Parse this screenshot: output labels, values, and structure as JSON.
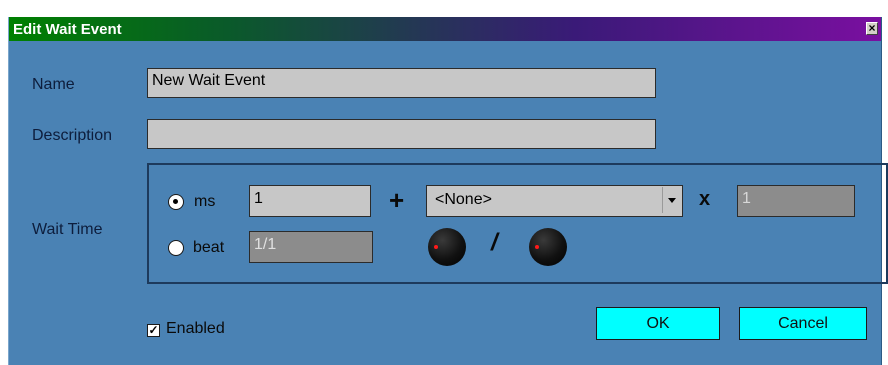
{
  "window": {
    "title": "Edit Wait Event",
    "close_glyph": "×"
  },
  "form": {
    "name_label": "Name",
    "name_value": "New Wait Event",
    "description_label": "Description",
    "description_value": "",
    "wait_time_label": "Wait Time"
  },
  "wait_time": {
    "ms_label": "ms",
    "ms_value": "1",
    "ms_selected": true,
    "beat_label": "beat",
    "beat_value": "1/1",
    "plus_symbol": "+",
    "times_symbol": "x",
    "divide_symbol": "/",
    "variable_selected": "<None>",
    "multiplier_value": "1"
  },
  "footer": {
    "enabled_label": "Enabled",
    "enabled_checked": true,
    "checkbox_glyph": "✓",
    "ok_label": "OK",
    "cancel_label": "Cancel"
  },
  "colors": {
    "window_bg": "#4a82b4",
    "title_gradient_start": "#008000",
    "title_gradient_end": "#7a0fa0",
    "button_bg": "#00ffff",
    "field_bg": "#c7c7c7",
    "disabled_field_bg": "#8c8c8c",
    "knob_indicator": "#ff1a1a"
  }
}
